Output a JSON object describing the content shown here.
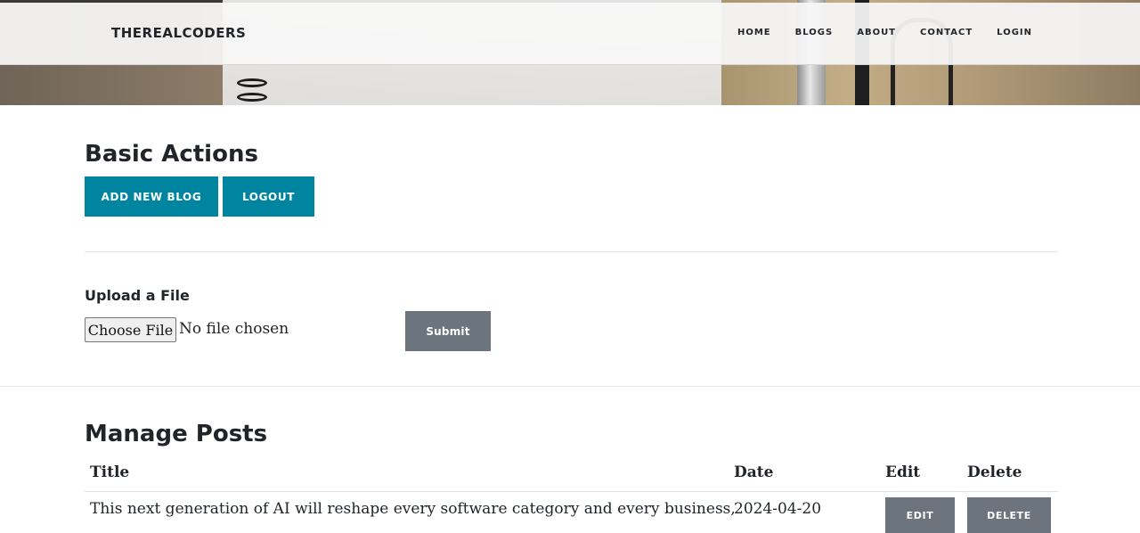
{
  "navbar": {
    "brand": "THEREALCODERS",
    "links": [
      "HOME",
      "BLOGS",
      "ABOUT",
      "CONTACT",
      "LOGIN"
    ]
  },
  "basic_actions": {
    "title": "Basic Actions",
    "add_new_blog_label": "ADD NEW BLOG",
    "logout_label": "LOGOUT"
  },
  "upload": {
    "title": "Upload a File",
    "choose_file_label": "Choose File",
    "file_status": "No file chosen",
    "submit_label": "Submit"
  },
  "manage_posts": {
    "title": "Manage Posts",
    "columns": [
      "Title",
      "Date",
      "Edit",
      "Delete"
    ],
    "rows": [
      {
        "title": "This next generation of AI will reshape every software category and every business,",
        "date": "2024-04-20",
        "edit_label": "EDIT",
        "delete_label": "DELETE"
      }
    ]
  },
  "colors": {
    "primary_button": "#0085a1",
    "secondary_button": "#6c757d",
    "text": "#212529"
  }
}
